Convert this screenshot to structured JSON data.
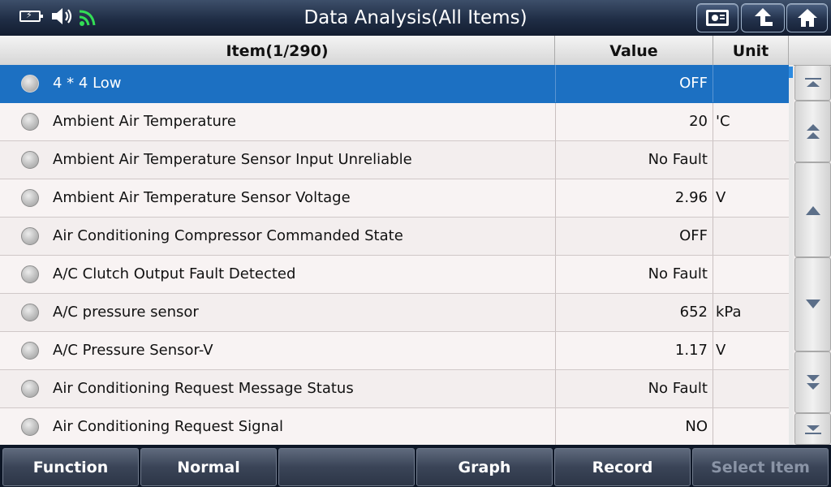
{
  "header": {
    "title": "Data Analysis(All Items)",
    "status_icons": [
      "battery-charging-icon",
      "volume-icon",
      "wifi-icon"
    ],
    "buttons": [
      "report-icon",
      "back-icon",
      "home-icon"
    ]
  },
  "table": {
    "columns": {
      "item": "Item(1/290)",
      "value": "Value",
      "unit": "Unit"
    },
    "rows": [
      {
        "name": "4 * 4 Low",
        "value": "OFF",
        "unit": "",
        "selected": true
      },
      {
        "name": "Ambient Air Temperature",
        "value": "20",
        "unit": "'C"
      },
      {
        "name": "Ambient Air Temperature Sensor Input Unreliable",
        "value": "No Fault",
        "unit": ""
      },
      {
        "name": "Ambient Air Temperature Sensor Voltage",
        "value": "2.96",
        "unit": "V"
      },
      {
        "name": "Air Conditioning Compressor Commanded State",
        "value": "OFF",
        "unit": ""
      },
      {
        "name": "A/C Clutch Output Fault Detected",
        "value": "No Fault",
        "unit": ""
      },
      {
        "name": "A/C pressure sensor",
        "value": "652",
        "unit": "kPa"
      },
      {
        "name": "A/C Pressure Sensor-V",
        "value": "1.17",
        "unit": "V"
      },
      {
        "name": "Air Conditioning Request Message Status",
        "value": "No Fault",
        "unit": ""
      },
      {
        "name": "Air Conditioning Request Signal",
        "value": "NO",
        "unit": ""
      }
    ]
  },
  "scroll_controls": [
    "scroll-top-icon",
    "page-up-icon",
    "scroll-up-icon",
    "scroll-down-icon",
    "page-down-icon",
    "scroll-bottom-icon"
  ],
  "toolbar": {
    "function_label": "Function",
    "normal_label": "Normal",
    "empty_label": "",
    "graph_label": "Graph",
    "record_label": "Record",
    "select_item_label": "Select Item"
  },
  "colors": {
    "selection": "#1c70c2",
    "topbar": "#1f2d45",
    "toolbar": "#3a4457"
  }
}
